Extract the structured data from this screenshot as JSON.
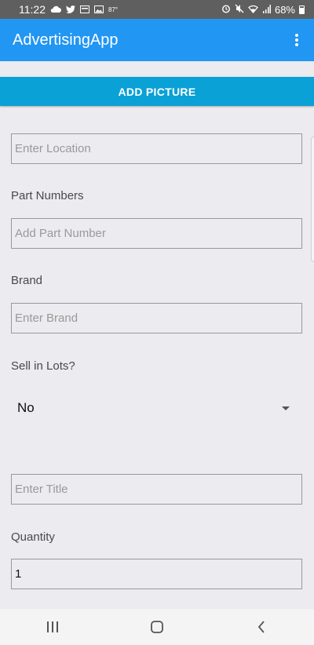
{
  "status_bar": {
    "time": "11:22",
    "temperature": "87°",
    "battery": "68%"
  },
  "app_bar": {
    "title": "AdvertisingApp"
  },
  "actions": {
    "add_picture_label": "ADD PICTURE"
  },
  "form": {
    "location_placeholder": "Enter Location",
    "part_numbers_label": "Part Numbers",
    "part_number_placeholder": "Add Part Number",
    "brand_label": "Brand",
    "brand_placeholder": "Enter Brand",
    "sell_in_lots_label": "Sell in Lots?",
    "sell_in_lots_value": "No",
    "title_placeholder": "Enter Title",
    "quantity_label": "Quantity",
    "quantity_value": "1"
  },
  "colors": {
    "app_bar": "#2196f3",
    "button": "#0aa1d6",
    "background": "#ebebf0",
    "status_bar": "#5f5f5f"
  },
  "icons": [
    "cloud-icon",
    "twitter-icon",
    "card-icon",
    "image-icon",
    "alarm-icon",
    "mute-icon",
    "wifi-icon",
    "signal-icon",
    "battery-icon",
    "more-vert-icon",
    "recents-icon",
    "home-icon",
    "back-icon"
  ]
}
